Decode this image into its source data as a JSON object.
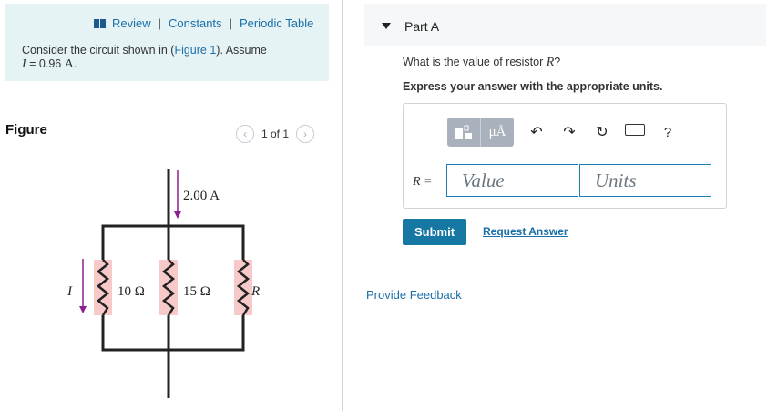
{
  "intro": {
    "links": [
      "Review",
      "Constants",
      "Periodic Table"
    ],
    "separator": "|",
    "text_before": "Consider the circuit shown in (",
    "figure_link": "Figure 1",
    "text_after": "). Assume",
    "current_var": "I",
    "current_value": " = 0.96 ",
    "current_unit": "A",
    "current_end": "."
  },
  "figure": {
    "label": "Figure",
    "pager": "1 of 1",
    "circuit": {
      "top_current": "2.00 A",
      "left_current_label": "I",
      "r1": "10 Ω",
      "r2": "15 Ω",
      "r3": "R"
    }
  },
  "part": {
    "title": "Part A",
    "question_before": "What is the value of resistor ",
    "question_var": "R",
    "question_after": "?",
    "instruction": "Express your answer with the appropriate units.",
    "answer_label": "R =",
    "value_placeholder": "Value",
    "units_placeholder": "Units",
    "toolbar": {
      "mu_label": "μÅ",
      "help_label": "?",
      "icons": [
        "templates-icon",
        "units-icon",
        "undo-icon",
        "redo-icon",
        "reset-icon",
        "keyboard-icon",
        "help-icon"
      ]
    },
    "submit_label": "Submit",
    "request_answer_label": "Request Answer"
  },
  "feedback_label": "Provide Feedback",
  "colors": {
    "link": "#1a6fa8",
    "intro_bg": "#e6f3f5",
    "submit_bg": "#1777a3",
    "arrow": "#8e1f8e",
    "resistor_fill": "#f7c9c9"
  }
}
